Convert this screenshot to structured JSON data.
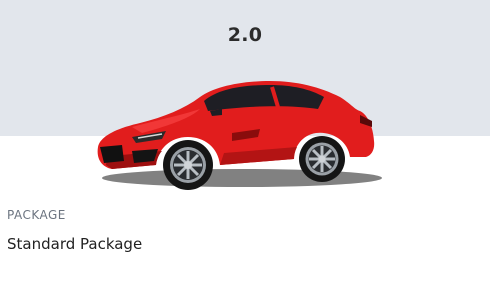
{
  "header": {
    "grade": "2.0"
  },
  "vehicle": {
    "image_icon": "red-sports-car",
    "body_color": "#e11d1d"
  },
  "package": {
    "label": "PACKAGE",
    "value": "Standard Package"
  }
}
